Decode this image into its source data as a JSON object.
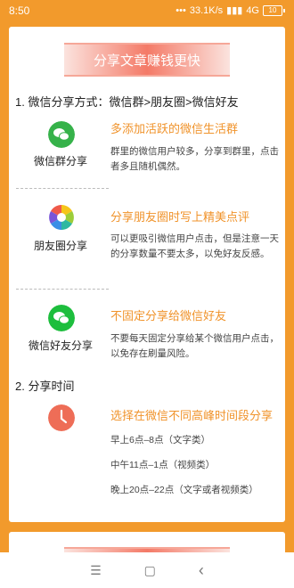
{
  "status": {
    "time": "8:50",
    "speed": "33.1K/s",
    "network": "4G",
    "battery": "10"
  },
  "title": "分享文章赚钱更快",
  "section1": "1. 微信分享方式：微信群>朋友圈>微信好友",
  "items": [
    {
      "name": "微信群分享",
      "title": "多添加活跃的微信生活群",
      "desc": "群里的微信用户较多，分享到群里，点击者多且随机偶然。",
      "icon": "wechat-group-icon"
    },
    {
      "name": "朋友圈分享",
      "title": "分享朋友圈时写上精美点评",
      "desc": "可以更吸引微信用户点击，但是注意一天的分享数量不要太多，以免好友反感。",
      "icon": "moments-icon"
    },
    {
      "name": "微信好友分享",
      "title": "不固定分享给微信好友",
      "desc": "不要每天固定分享给某个微信用户点击，以免存在刷量风险。",
      "icon": "wechat-friend-icon"
    }
  ],
  "section2": "2. 分享时间",
  "time": {
    "title": "选择在微信不同高峰时间段分享",
    "lines": [
      "早上6点–8点（文字类）",
      "中午11点–1点（视频类）",
      "晚上20点–22点（文字或者视频类）"
    ]
  },
  "nav": {
    "menu": "☰",
    "home": "▢",
    "back": "‹"
  }
}
